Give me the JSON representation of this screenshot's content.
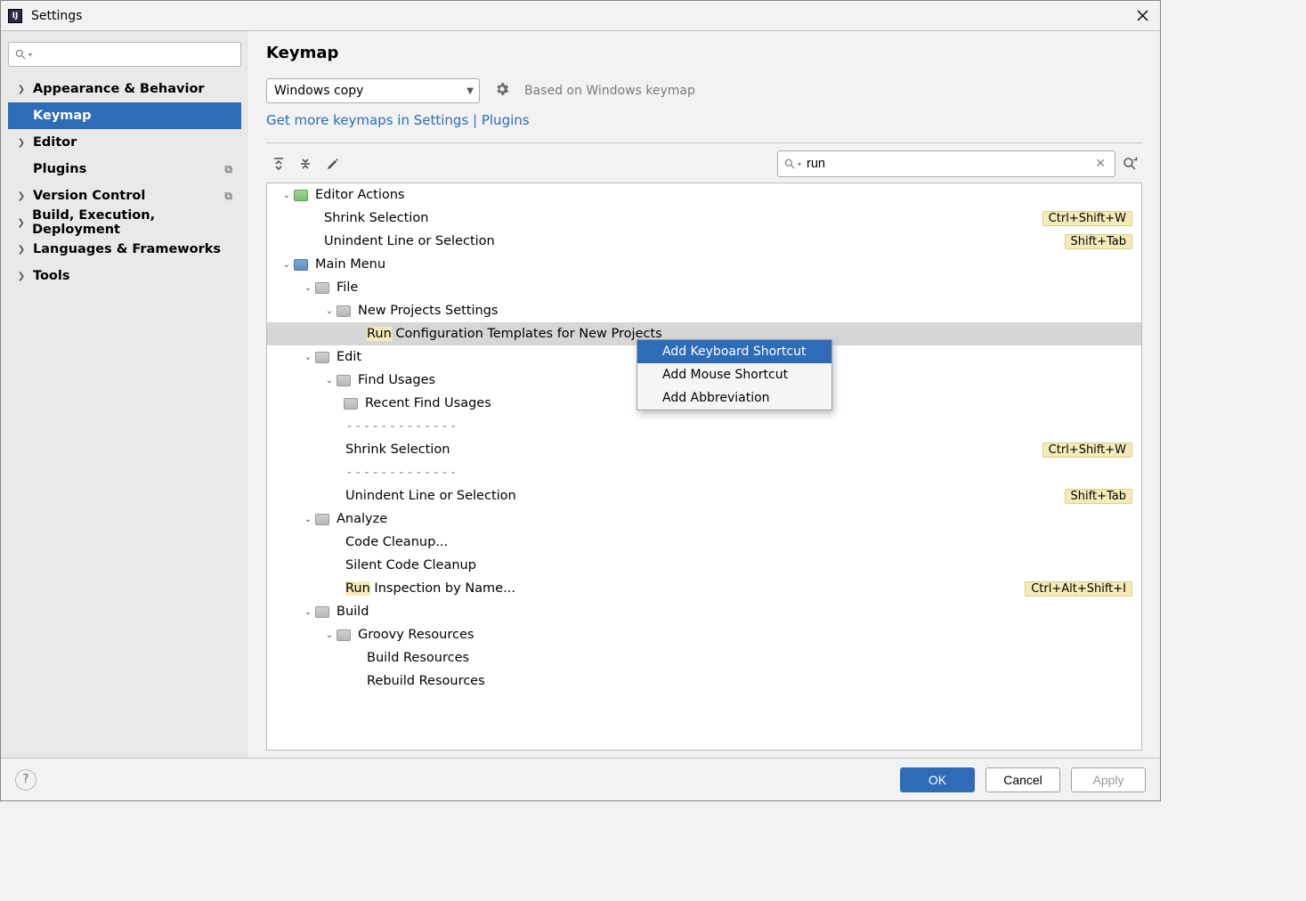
{
  "window": {
    "title": "Settings"
  },
  "sidebar": {
    "items": [
      {
        "label": "Appearance & Behavior"
      },
      {
        "label": "Keymap"
      },
      {
        "label": "Editor"
      },
      {
        "label": "Plugins"
      },
      {
        "label": "Version Control"
      },
      {
        "label": "Build, Execution, Deployment"
      },
      {
        "label": "Languages & Frameworks"
      },
      {
        "label": "Tools"
      }
    ]
  },
  "main": {
    "heading": "Keymap",
    "keymap_selected": "Windows copy",
    "based_on": "Based on Windows keymap",
    "link_text": "Get more keymaps in Settings | Plugins",
    "search_value": "run"
  },
  "tree": {
    "r0": {
      "label": "Editor Actions"
    },
    "r1": {
      "label": "Shrink Selection",
      "shortcut": "Ctrl+Shift+W"
    },
    "r2": {
      "label": "Unindent Line or Selection",
      "shortcut": "Shift+Tab"
    },
    "r3": {
      "label": "Main Menu"
    },
    "r4": {
      "label": "File"
    },
    "r5": {
      "label": "New Projects Settings"
    },
    "r6": {
      "prefix": "Run",
      "rest": " Configuration Templates for New Projects"
    },
    "r7": {
      "label": "Edit"
    },
    "r8": {
      "label": "Find Usages"
    },
    "r9": {
      "label": "Recent Find Usages"
    },
    "r10": {
      "label": "-------------"
    },
    "r11": {
      "label": "Shrink Selection",
      "shortcut": "Ctrl+Shift+W"
    },
    "r12": {
      "label": "-------------"
    },
    "r13": {
      "label": "Unindent Line or Selection",
      "shortcut": "Shift+Tab"
    },
    "r14": {
      "label": "Analyze"
    },
    "r15": {
      "label": "Code Cleanup..."
    },
    "r16": {
      "label": "Silent Code Cleanup"
    },
    "r17": {
      "prefix": "Run",
      "rest": " Inspection by Name...",
      "shortcut": "Ctrl+Alt+Shift+I"
    },
    "r18": {
      "label": "Build"
    },
    "r19": {
      "label": "Groovy Resources"
    },
    "r20": {
      "label": "Build Resources"
    },
    "r21": {
      "label": "Rebuild Resources"
    }
  },
  "context_menu": {
    "i0": "Add Keyboard Shortcut",
    "i1": "Add Mouse Shortcut",
    "i2": "Add Abbreviation"
  },
  "footer": {
    "ok": "OK",
    "cancel": "Cancel",
    "apply": "Apply"
  }
}
